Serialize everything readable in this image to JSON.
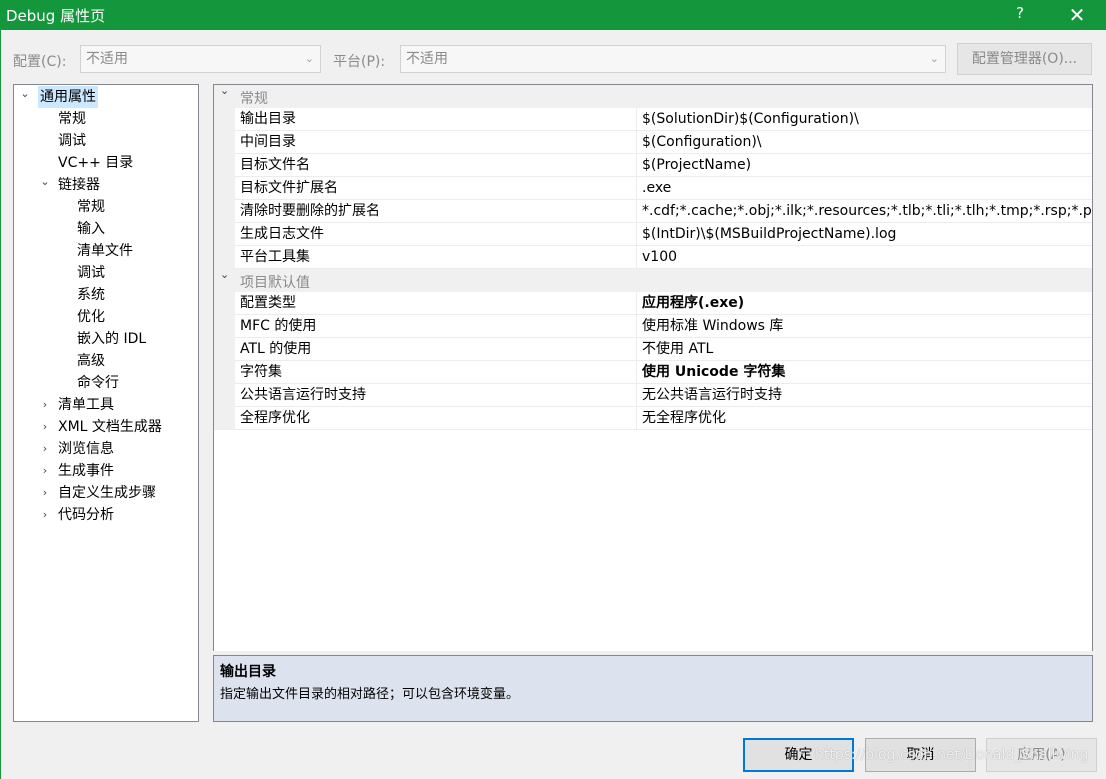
{
  "window": {
    "title": "Debug 属性页",
    "help_label": "?",
    "close_label": "✕"
  },
  "toolbar": {
    "config_label": "配置(C):",
    "config_value": "不适用",
    "platform_label": "平台(P):",
    "platform_value": "不适用",
    "config_manager_label": "配置管理器(O)..."
  },
  "tree": {
    "items": [
      {
        "label": "通用属性",
        "expander": "down",
        "selected": true
      },
      {
        "label": "常规"
      },
      {
        "label": "调试"
      },
      {
        "label": "VC++ 目录"
      },
      {
        "label": "链接器",
        "expander": "down"
      },
      {
        "label": "常规"
      },
      {
        "label": "输入"
      },
      {
        "label": "清单文件"
      },
      {
        "label": "调试"
      },
      {
        "label": "系统"
      },
      {
        "label": "优化"
      },
      {
        "label": "嵌入的 IDL"
      },
      {
        "label": "高级"
      },
      {
        "label": "命令行"
      },
      {
        "label": "清单工具",
        "expander": "right"
      },
      {
        "label": "XML 文档生成器",
        "expander": "right"
      },
      {
        "label": "浏览信息",
        "expander": "right"
      },
      {
        "label": "生成事件",
        "expander": "right"
      },
      {
        "label": "自定义生成步骤",
        "expander": "right"
      },
      {
        "label": "代码分析",
        "expander": "right"
      }
    ]
  },
  "grid": {
    "categories": [
      {
        "label": "常规",
        "properties": [
          {
            "name": "输出目录",
            "value": "$(SolutionDir)$(Configuration)\\"
          },
          {
            "name": "中间目录",
            "value": "$(Configuration)\\"
          },
          {
            "name": "目标文件名",
            "value": "$(ProjectName)"
          },
          {
            "name": "目标文件扩展名",
            "value": ".exe"
          },
          {
            "name": "清除时要删除的扩展名",
            "value": "*.cdf;*.cache;*.obj;*.ilk;*.resources;*.tlb;*.tli;*.tlh;*.tmp;*.rsp;*.p"
          },
          {
            "name": "生成日志文件",
            "value": "$(IntDir)\\$(MSBuildProjectName).log"
          },
          {
            "name": "平台工具集",
            "value": "v100"
          }
        ]
      },
      {
        "label": "项目默认值",
        "properties": [
          {
            "name": "配置类型",
            "value": "应用程序(.exe)",
            "bold": true
          },
          {
            "name": "MFC 的使用",
            "value": "使用标准 Windows 库"
          },
          {
            "name": "ATL 的使用",
            "value": "不使用 ATL"
          },
          {
            "name": "字符集",
            "value": "使用 Unicode 字符集",
            "bold": true
          },
          {
            "name": "公共语言运行时支持",
            "value": "无公共语言运行时支持"
          },
          {
            "name": "全程序优化",
            "value": "无全程序优化"
          }
        ]
      }
    ]
  },
  "description": {
    "title": "输出目录",
    "text": "指定输出文件目录的相对路径；可以包含环境变量。"
  },
  "buttons": {
    "ok": "确定",
    "cancel": "取消",
    "apply": "应用(A)"
  },
  "watermark": "https://blog.csdn.net/Donald_Shallwing"
}
